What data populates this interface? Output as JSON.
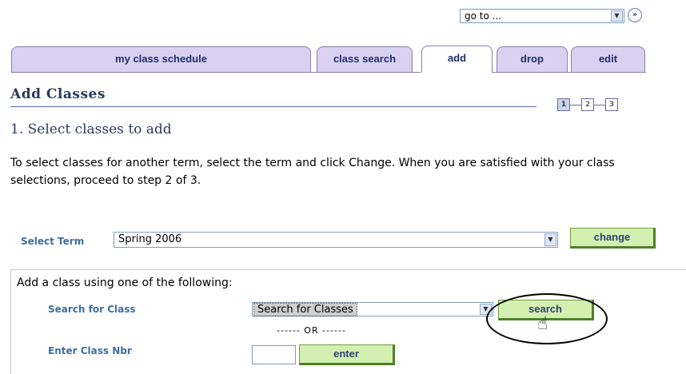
{
  "goto": {
    "label": "go to ...",
    "arrow_icon": "dropdown-arrow-icon",
    "go_icon": "double-chevron-right-icon"
  },
  "tabs": [
    {
      "label": "my class schedule",
      "active": false
    },
    {
      "label": "class search",
      "active": false
    },
    {
      "label": "add",
      "active": true
    },
    {
      "label": "drop",
      "active": false
    },
    {
      "label": "edit",
      "active": false
    }
  ],
  "heading": "Add Classes",
  "steps": {
    "labels": [
      "1",
      "2",
      "3"
    ],
    "current": 1
  },
  "section_title": "1. Select classes to add",
  "instructions": "To select classes for another term, select the term and click Change. When you are satisfied with your class selections, proceed to step 2 of 3.",
  "term": {
    "label": "Select Term",
    "value": "Spring 2006",
    "change_button": "change"
  },
  "add_class": {
    "title": "Add a class using one of the following:",
    "search_label": "Search for Class",
    "search_select_value": "Search for Classes",
    "search_button": "search",
    "or_text": "------ OR ------",
    "nbr_label": "Enter Class Nbr",
    "nbr_value": "",
    "enter_button": "enter"
  },
  "colors": {
    "tab_bg": "#d9d1f0",
    "button_bg": "#d3f0b0",
    "label_blue": "#3e6ea3",
    "heading": "#2b3a5a"
  }
}
